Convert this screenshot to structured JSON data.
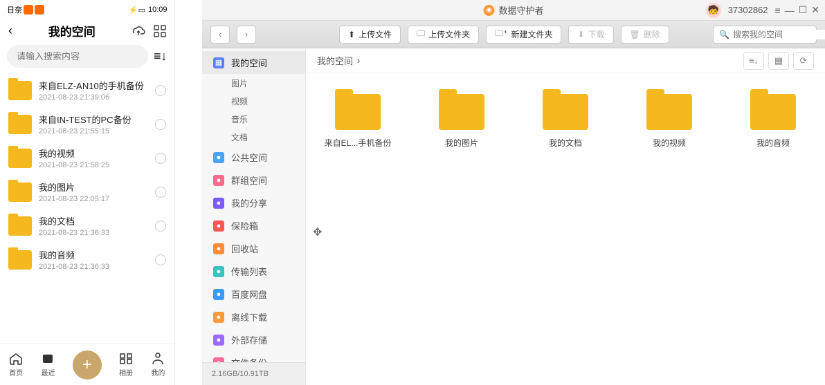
{
  "mobile": {
    "status_time": "10:09",
    "title": "我的空间",
    "search_placeholder": "请输入搜索内容",
    "items": [
      {
        "name": "来自ELZ-AN10的手机备份",
        "date": "2021-08-23 21:39:06"
      },
      {
        "name": "来自IN-TEST的PC备份",
        "date": "2021-08-23 21:55:15"
      },
      {
        "name": "我的视频",
        "date": "2021-08-23 21:58:25"
      },
      {
        "name": "我的图片",
        "date": "2021-08-23 22:05:17"
      },
      {
        "name": "我的文档",
        "date": "2021-08-23 21:36:33"
      },
      {
        "name": "我的音频",
        "date": "2021-08-23 21:36:33"
      }
    ],
    "nav": {
      "home": "首页",
      "recent": "最近",
      "album": "相册",
      "mine": "我的"
    }
  },
  "desktop": {
    "app_title": "数据守护者",
    "user_id": "37302862",
    "toolbar": {
      "upload_file": "上传文件",
      "upload_folder": "上传文件夹",
      "new_folder": "新建文件夹",
      "download": "下载",
      "delete": "删除",
      "search_placeholder": "搜索我的空间"
    },
    "sidebar": {
      "my_space": "我的空间",
      "subs": [
        "图片",
        "视频",
        "音乐",
        "文档"
      ],
      "items": [
        {
          "label": "公共空间",
          "color": "#4aa3ff"
        },
        {
          "label": "群组空间",
          "color": "#ff6b8a"
        },
        {
          "label": "我的分享",
          "color": "#7b5cff"
        },
        {
          "label": "保险箱",
          "color": "#ff5555"
        },
        {
          "label": "回收站",
          "color": "#ff8c3a"
        },
        {
          "label": "传输列表",
          "color": "#3ac2c2"
        },
        {
          "label": "百度网盘",
          "color": "#3a9bff"
        },
        {
          "label": "离线下载",
          "color": "#ff9a3a"
        },
        {
          "label": "外部存储",
          "color": "#9b6bff"
        },
        {
          "label": "文件备份",
          "color": "#ff6b9b"
        }
      ],
      "storage": "2.16GB/10.91TB"
    },
    "breadcrumb": "我的空间",
    "folders": [
      "来自EL...手机备份",
      "我的图片",
      "我的文档",
      "我的视频",
      "我的音频"
    ]
  }
}
